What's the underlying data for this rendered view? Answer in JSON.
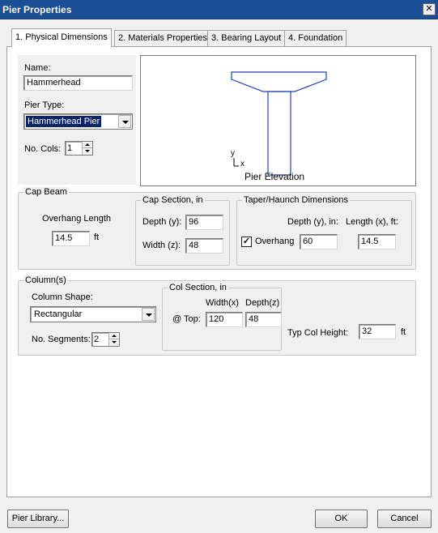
{
  "window": {
    "title": "Pier Properties",
    "close_glyph": "✕"
  },
  "tabs": [
    {
      "label": "1. Physical Dimensions",
      "active": true
    },
    {
      "label": "2. Materials Properties",
      "active": false
    },
    {
      "label": "3. Bearing Layout",
      "active": false
    },
    {
      "label": "4. Foundation",
      "active": false
    }
  ],
  "general": {
    "name_label": "Name:",
    "name_value": "Hammerhead",
    "pier_type_label": "Pier Type:",
    "pier_type_value": "Hammerhead Pier",
    "no_cols_label": "No. Cols:",
    "no_cols_value": "1"
  },
  "elevation": {
    "axis_y": "y",
    "axis_x": "x",
    "caption": "Pier Elevation",
    "line_color": "#1f3fb8"
  },
  "cap_beam": {
    "legend": "Cap Beam",
    "overhang_label": "Overhang Length",
    "overhang_value": "14.5",
    "overhang_unit": "ft",
    "cap_section": {
      "legend": "Cap Section, in",
      "depth_label": "Depth (y):",
      "depth_value": "96",
      "width_label": "Width (z):",
      "width_value": "48"
    },
    "taper": {
      "legend": "Taper/Haunch Dimensions",
      "depth_header": "Depth (y), in:",
      "length_header": "Length (x), ft:",
      "overhang_checked": true,
      "overhang_label": "Overhang",
      "depth_value": "60",
      "length_value": "14.5"
    }
  },
  "columns": {
    "legend": "Column(s)",
    "shape_label": "Column Shape:",
    "shape_value": "Rectangular",
    "segments_label": "No. Segments:",
    "segments_value": "2",
    "col_section": {
      "legend": "Col Section, in",
      "width_header": "Width(x)",
      "depth_header": "Depth(z)",
      "top_label": "@ Top:",
      "width_value": "120",
      "depth_value": "48"
    },
    "typ_height_label": "Typ Col Height:",
    "typ_height_value": "32",
    "typ_height_unit": "ft"
  },
  "footer": {
    "library_button": "Pier Library...",
    "ok_button": "OK",
    "cancel_button": "Cancel"
  },
  "check_glyph": "✓"
}
